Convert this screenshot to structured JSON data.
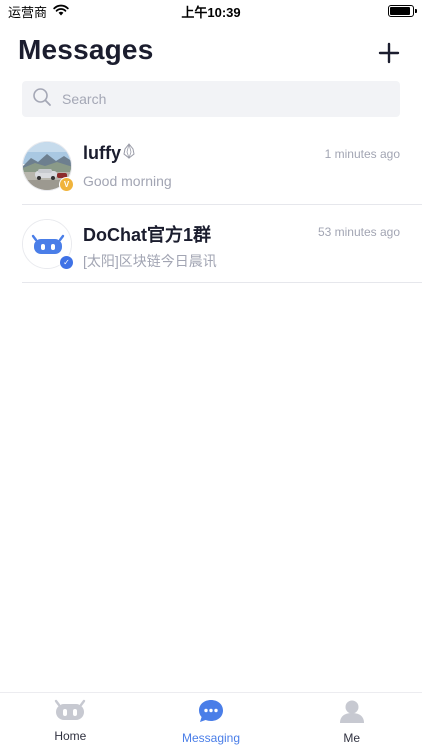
{
  "status_bar": {
    "carrier": "运营商",
    "time": "上午10:39",
    "battery_level": 0.9
  },
  "header": {
    "title": "Messages",
    "add_icon": "plus-icon"
  },
  "search": {
    "placeholder": "Search",
    "value": "",
    "icon": "search-icon"
  },
  "conversations": [
    {
      "name": "luffy",
      "time": "1 minutes ago",
      "preview": "Good morning",
      "badge": "V",
      "badge_color": "#f0b43c",
      "name_icon": "eos-icon"
    },
    {
      "name": "DoChat官方1群",
      "time": "53 minutes ago",
      "preview": "[太阳]区块链今日晨讯",
      "badge": "✓",
      "badge_color": "#3f72e6",
      "name_icon": ""
    }
  ],
  "tabs": [
    {
      "label": "Home",
      "icon": "robot-home-icon",
      "active": false
    },
    {
      "label": "Messaging",
      "icon": "chat-bubble-icon",
      "active": true
    },
    {
      "label": "Me",
      "icon": "person-icon",
      "active": false
    }
  ],
  "colors": {
    "accent": "#4a7ee8",
    "title": "#1b1d2e",
    "muted": "#a2a5b3",
    "search_bg": "#f2f3f6",
    "divider": "#e6e7ec"
  }
}
